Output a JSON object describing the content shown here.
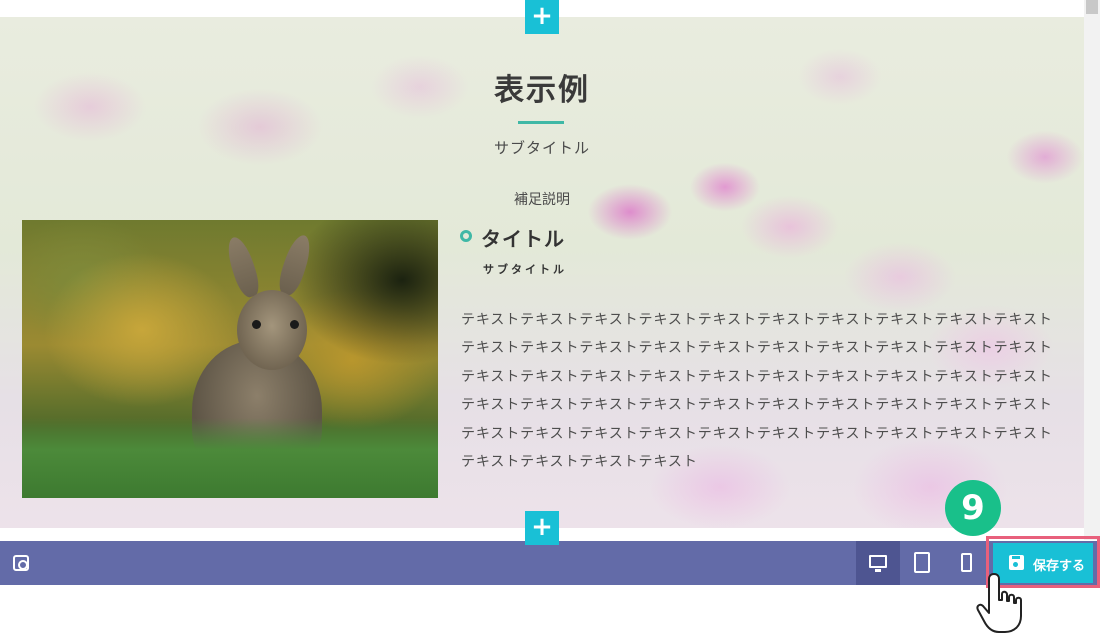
{
  "hero": {
    "title": "表示例",
    "subtitle": "サブタイトル",
    "description": "補足説明",
    "add_top_label": "+",
    "add_bottom_label": "+"
  },
  "item": {
    "title": "タイトル",
    "subtitle": "サブタイトル",
    "body": "テキストテキストテキストテキストテキストテキストテキストテキストテキストテキストテキストテキストテキストテキストテキストテキストテキストテキストテキストテキストテキストテキストテキストテキストテキストテキストテキストテキストテキストテキストテキストテキストテキストテキストテキストテキストテキストテキストテキストテキストテキストテキストテキストテキストテキストテキストテキストテキストテキストテキストテキストテキストテキストテキスト"
  },
  "toolbar": {
    "save_label": "保存する",
    "active_device": "desktop"
  },
  "step_badge": "9",
  "colors": {
    "accent": "#19c0d6",
    "toolbar": "#636ba8",
    "highlight": "#e8607c",
    "badge": "#19c08a",
    "title_underline": "#3fb8a6"
  },
  "icons": [
    "settings-icon",
    "desktop-icon",
    "tablet-icon",
    "phone-icon",
    "save-icon",
    "hand-cursor-icon"
  ]
}
